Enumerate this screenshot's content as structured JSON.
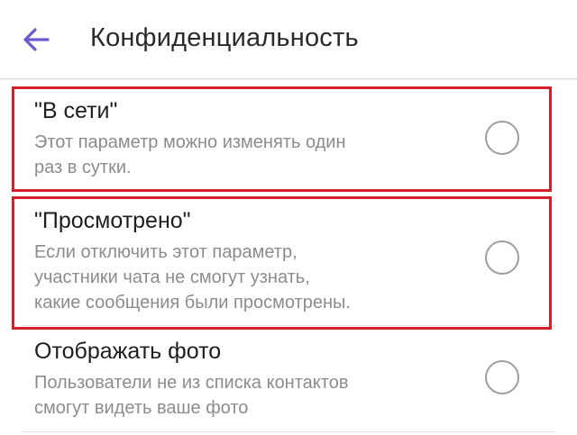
{
  "header": {
    "title": "Конфиденциальность",
    "back_icon": "arrow-left-icon"
  },
  "colors": {
    "accent": "#6a5acd",
    "highlight": "#d51f2b",
    "title_text": "#1e1e1e",
    "desc_text": "#8c8c8c"
  },
  "settings": [
    {
      "title": "\"В сети\"",
      "desc_lines": [
        "Этот параметр можно изменять один",
        "раз в сутки."
      ],
      "checked": false,
      "highlighted": true
    },
    {
      "title": "\"Просмотрено\"",
      "desc_lines": [
        "Если отключить этот параметр,",
        "участники чата не смогут узнать,",
        "какие сообщения были просмотрены."
      ],
      "checked": false,
      "highlighted": true
    },
    {
      "title": "Отображать фото",
      "desc_lines": [
        "Пользователи не из списка контактов",
        "смогут видеть ваше фото"
      ],
      "checked": false,
      "highlighted": false
    }
  ]
}
